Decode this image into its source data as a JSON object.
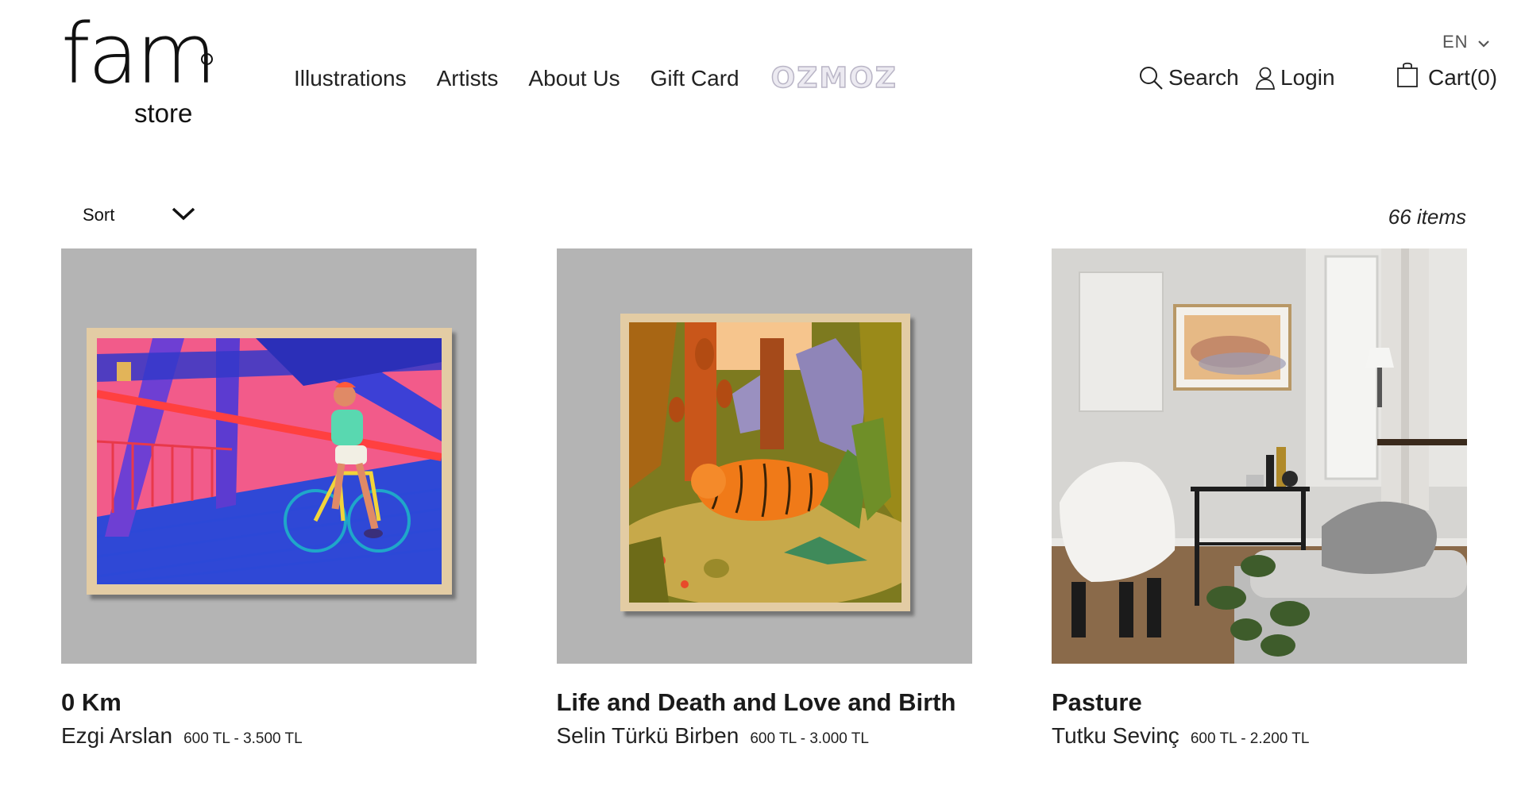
{
  "brand": {
    "main": "fam",
    "sub": "store"
  },
  "nav": {
    "items": [
      {
        "label": "Illustrations"
      },
      {
        "label": "Artists"
      },
      {
        "label": "About Us"
      },
      {
        "label": "Gift Card"
      }
    ],
    "ozmoz": "OZMOZ"
  },
  "header": {
    "language": "EN",
    "search_label": "Search",
    "login_label": "Login",
    "cart_label": "Cart(0)"
  },
  "toolbar": {
    "sort_label": "Sort",
    "item_count": "66 items"
  },
  "products": [
    {
      "title": "0 Km",
      "artist": "Ezgi Arslan",
      "price": "600 TL - 3.500 TL"
    },
    {
      "title": "Life and Death and Love and Birth",
      "artist": "Selin Türkü Birben",
      "price": "600 TL - 3.000 TL"
    },
    {
      "title": "Pasture",
      "artist": "Tutku Sevinç",
      "price": "600 TL - 2.200 TL"
    }
  ],
  "colors": {
    "thumb_bg": "#b4b4b4",
    "frame": "#e3cca4",
    "text": "#1a1a1a"
  }
}
